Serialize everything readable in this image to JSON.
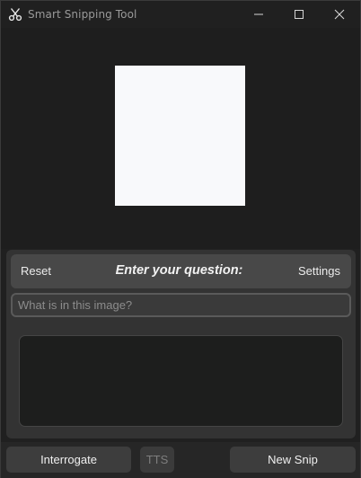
{
  "window": {
    "title": "Smart Snipping Tool",
    "app_icon": "scissors-icon",
    "controls": {
      "minimize_icon": "minimize-icon",
      "maximize_icon": "maximize-icon",
      "close_icon": "close-icon"
    }
  },
  "preview": {
    "image_color": "#f8f9fb"
  },
  "question_panel": {
    "reset_label": "Reset",
    "title": "Enter your question:",
    "settings_label": "Settings",
    "input_placeholder": "What is in this image?",
    "input_value": "",
    "answer_text": ""
  },
  "footer": {
    "interrogate_label": "Interrogate",
    "tts_label": "TTS",
    "new_snip_label": "New Snip"
  },
  "colors": {
    "background": "#202020",
    "panel": "#333333",
    "header_bar": "#484848",
    "button": "#3d3d3d",
    "disabled_text": "#7e7e7e"
  }
}
